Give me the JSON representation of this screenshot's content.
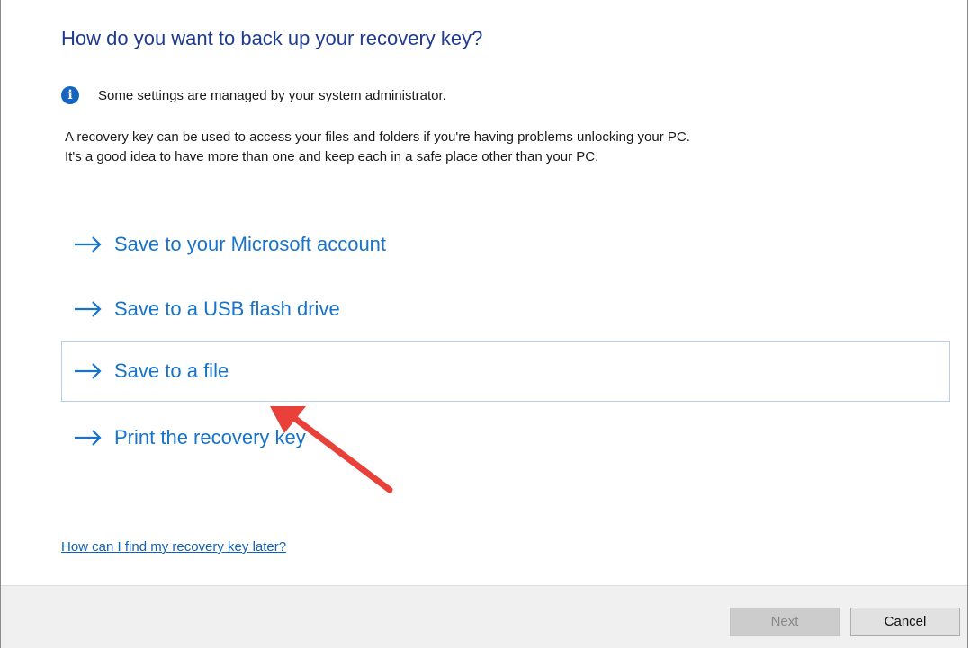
{
  "dialog": {
    "title": "How do you want to back up your recovery key?",
    "notice": "Some settings are managed by your system administrator.",
    "description_lines": [
      "A recovery key can be used to access your files and folders if you're having problems unlocking your PC.",
      "It's a good idea to have more than one and keep each in a safe place other than your PC."
    ],
    "options": [
      {
        "label": "Save to your Microsoft account",
        "hovered": false
      },
      {
        "label": "Save to a USB flash drive",
        "hovered": false
      },
      {
        "label": "Save to a file",
        "hovered": true
      },
      {
        "label": "Print the recovery key",
        "hovered": false
      }
    ],
    "help_link": "How can I find my recovery key later?"
  },
  "footer": {
    "next_label": "Next",
    "next_enabled": false,
    "cancel_label": "Cancel"
  },
  "icons": {
    "info": "info-icon",
    "option_arrow": "arrow-right-icon"
  },
  "colors": {
    "title": "#1f3b8f",
    "link": "#1873c9",
    "info_icon": "#1565c0",
    "annotation_arrow": "#e8413a",
    "hover_border": "#b8cde6"
  }
}
